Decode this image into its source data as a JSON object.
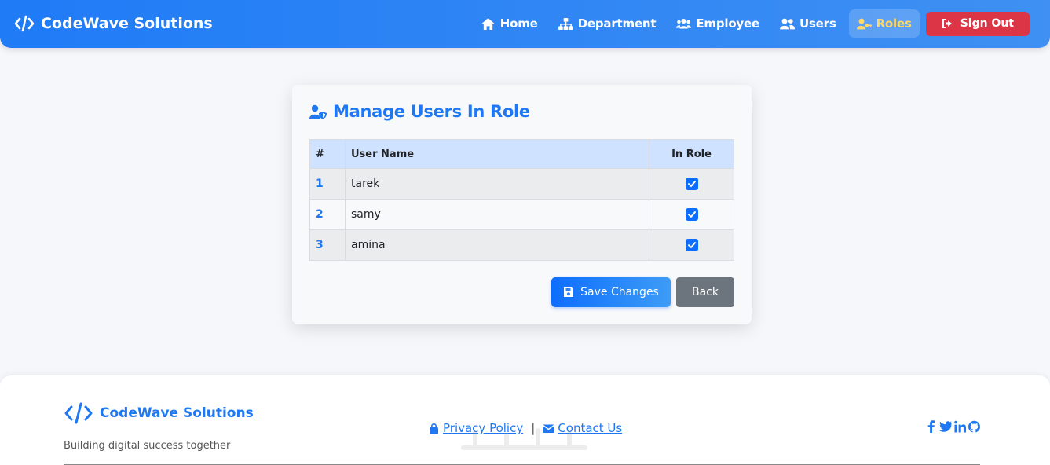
{
  "nav": {
    "brand": "CodeWave Solutions",
    "links": [
      {
        "label": "Home",
        "icon": "home-icon"
      },
      {
        "label": "Department",
        "icon": "sitemap-icon"
      },
      {
        "label": "Employee",
        "icon": "users-icon"
      },
      {
        "label": "Users",
        "icon": "user-group-icon"
      },
      {
        "label": "Roles",
        "icon": "user-key-icon",
        "active": true
      }
    ],
    "signout": "Sign Out"
  },
  "card": {
    "title": "Manage Users In Role",
    "table": {
      "headers": [
        "#",
        "User Name",
        "In Role"
      ],
      "rows": [
        {
          "num": "1",
          "name": "tarek",
          "in_role": true
        },
        {
          "num": "2",
          "name": "samy",
          "in_role": true
        },
        {
          "num": "3",
          "name": "amina",
          "in_role": true
        }
      ]
    },
    "save_label": "Save Changes",
    "back_label": "Back"
  },
  "footer": {
    "brand": "CodeWave Solutions",
    "tagline": "Building digital success together",
    "privacy": "Privacy Policy",
    "separator": "|",
    "contact": "Contact Us"
  },
  "colors": {
    "primary": "#1f78f2",
    "danger": "#dc3545",
    "secondary": "#6c757d",
    "active_nav": "#ffd866"
  }
}
